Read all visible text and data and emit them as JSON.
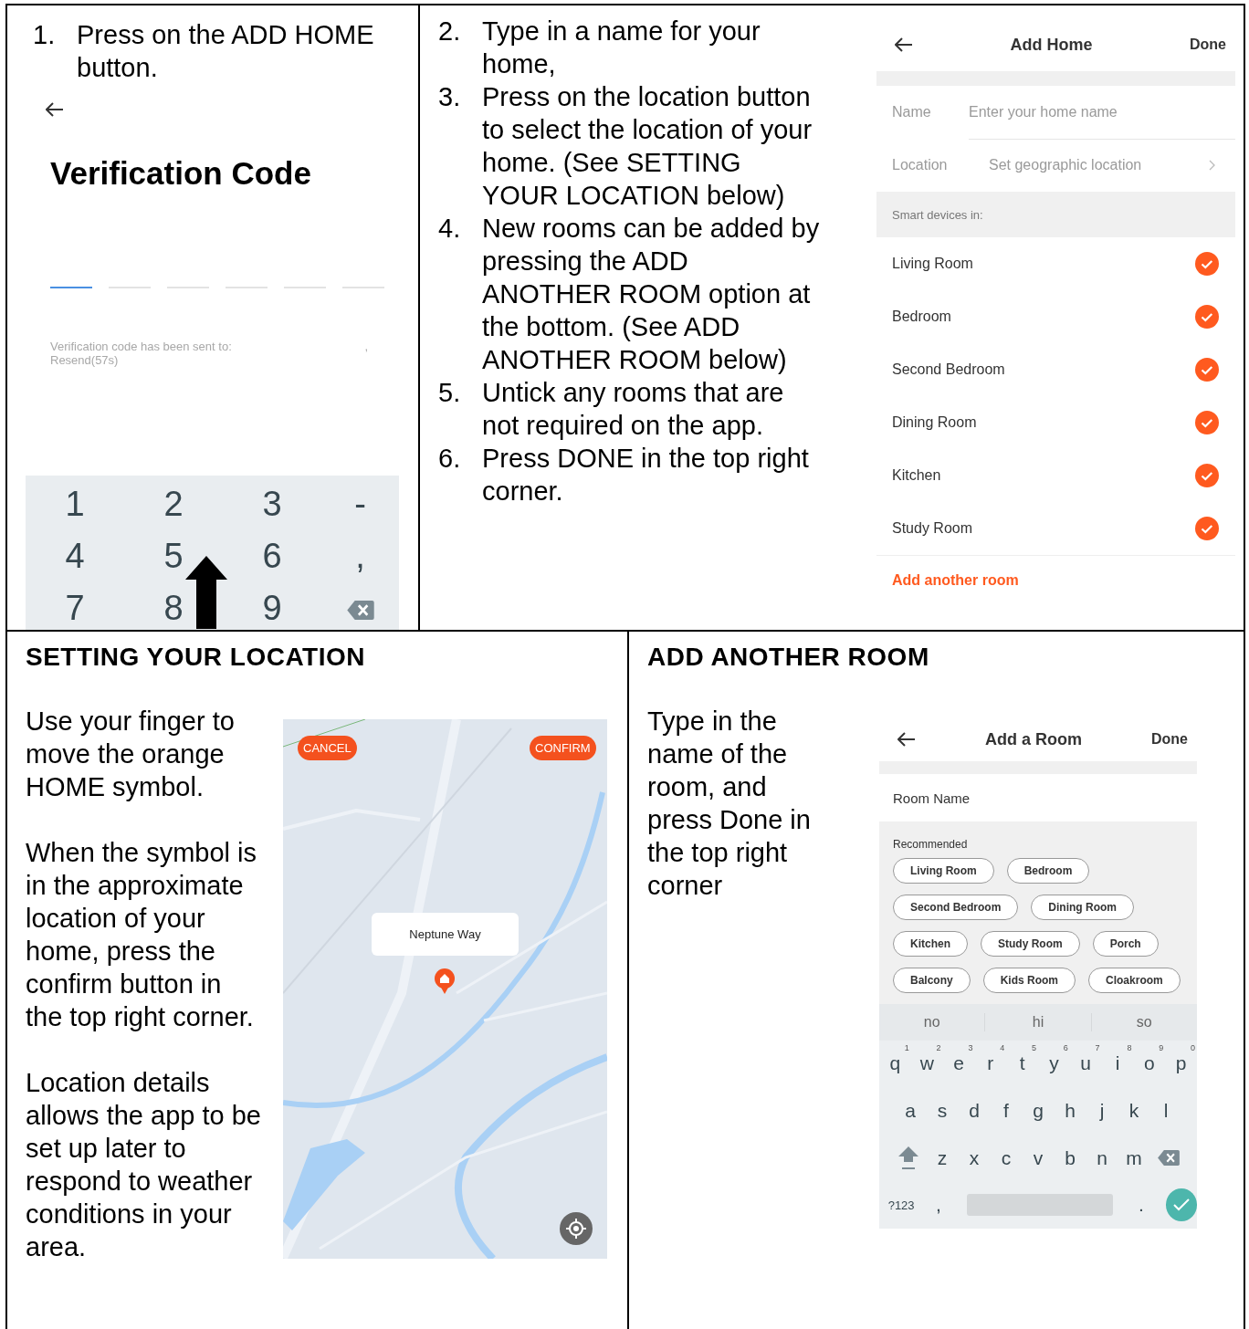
{
  "add_home_step": {
    "steps": [
      {
        "number": "1.",
        "text": "Press on the ADD HOME button."
      }
    ],
    "screen": {
      "title": "Verification Code",
      "code_slots": [
        {
          "selected": true
        },
        {
          "selected": false
        },
        {
          "selected": false
        },
        {
          "selected": false
        },
        {
          "selected": false
        },
        {
          "selected": false
        }
      ],
      "message": "Verification code has been sent to:",
      "message_tail": ",",
      "resend": "Resend(57s)",
      "keypad": [
        {
          "kind": "char",
          "label": "1"
        },
        {
          "kind": "char",
          "label": "2"
        },
        {
          "kind": "char",
          "label": "3"
        },
        {
          "kind": "char",
          "label": "-"
        },
        {
          "kind": "char",
          "label": "4"
        },
        {
          "kind": "char",
          "label": "5"
        },
        {
          "kind": "char",
          "label": "6"
        },
        {
          "kind": "char",
          "label": ","
        },
        {
          "kind": "char",
          "label": "7"
        },
        {
          "kind": "char",
          "label": "8"
        },
        {
          "kind": "char",
          "label": "9"
        },
        {
          "kind": "backspace"
        }
      ]
    }
  },
  "name_home_step": {
    "steps": [
      {
        "number": "2.",
        "text": "Type in a name for your home,"
      },
      {
        "number": "3.",
        "text": "Press on the location button to select the location of your home.  (See SETTING YOUR LOCATION below)"
      },
      {
        "number": "4.",
        "text": "New rooms can be added by pressing the ADD ANOTHER ROOM option at the bottom. (See ADD ANOTHER ROOM below)"
      },
      {
        "number": "5.",
        "text": "Untick any rooms that are not required on the app."
      },
      {
        "number": "6.",
        "text": "Press DONE in the top right corner."
      }
    ],
    "screen": {
      "title": "Add Home",
      "done": "Done",
      "name_label": "Name",
      "name_placeholder": "Enter your home name",
      "location_label": "Location",
      "location_value": "Set geographic location",
      "section_label": "Smart devices in:",
      "rooms": [
        {
          "name": "Living Room",
          "checked": true
        },
        {
          "name": "Bedroom",
          "checked": true
        },
        {
          "name": "Second Bedroom",
          "checked": true
        },
        {
          "name": "Dining Room",
          "checked": true
        },
        {
          "name": "Kitchen",
          "checked": true
        },
        {
          "name": "Study Room",
          "checked": true
        }
      ],
      "add_room": "Add another room"
    }
  },
  "location_section": {
    "heading": "SETTING YOUR LOCATION",
    "paragraphs": [
      "Use your finger to move the orange HOME symbol.",
      "When the symbol is in the approximate location of your home, press the confirm button in the top right corner.",
      "Location details allows the app to be set up later to respond to weather conditions in your area."
    ],
    "map": {
      "cancel": "CANCEL",
      "confirm": "CONFIRM",
      "callout": "Neptune Way"
    }
  },
  "add_room_section": {
    "heading": "ADD ANOTHER ROOM",
    "paragraph": "Type in the name of the room, and press Done in the top right corner",
    "screen": {
      "title": "Add a Room",
      "done": "Done",
      "room_name_placeholder": "Room Name",
      "recommended_label": "Recommended",
      "chip_rows": [
        [
          "Living Room",
          "Bedroom"
        ],
        [
          "Second Bedroom",
          "Dining Room"
        ],
        [
          "Kitchen",
          "Study Room",
          "Porch"
        ],
        [
          "Balcony",
          "Kids Room",
          "Cloakroom"
        ]
      ],
      "suggestions": [
        "no",
        "hi",
        "so"
      ],
      "keyboard": [
        [
          {
            "kind": "char",
            "label": "q",
            "hint": "1"
          },
          {
            "kind": "char",
            "label": "w",
            "hint": "2"
          },
          {
            "kind": "char",
            "label": "e",
            "hint": "3"
          },
          {
            "kind": "char",
            "label": "r",
            "hint": "4"
          },
          {
            "kind": "char",
            "label": "t",
            "hint": "5"
          },
          {
            "kind": "char",
            "label": "y",
            "hint": "6"
          },
          {
            "kind": "char",
            "label": "u",
            "hint": "7"
          },
          {
            "kind": "char",
            "label": "i",
            "hint": "8"
          },
          {
            "kind": "char",
            "label": "o",
            "hint": "9"
          },
          {
            "kind": "char",
            "label": "p",
            "hint": "0"
          }
        ],
        [
          {
            "kind": "char",
            "label": "a"
          },
          {
            "kind": "char",
            "label": "s"
          },
          {
            "kind": "char",
            "label": "d"
          },
          {
            "kind": "char",
            "label": "f"
          },
          {
            "kind": "char",
            "label": "g"
          },
          {
            "kind": "char",
            "label": "h"
          },
          {
            "kind": "char",
            "label": "j"
          },
          {
            "kind": "char",
            "label": "k"
          },
          {
            "kind": "char",
            "label": "l"
          }
        ],
        [
          {
            "kind": "shift"
          },
          {
            "kind": "char",
            "label": "z"
          },
          {
            "kind": "char",
            "label": "x"
          },
          {
            "kind": "char",
            "label": "c"
          },
          {
            "kind": "char",
            "label": "v"
          },
          {
            "kind": "char",
            "label": "b"
          },
          {
            "kind": "char",
            "label": "n"
          },
          {
            "kind": "char",
            "label": "m"
          },
          {
            "kind": "backspace"
          }
        ],
        [
          {
            "kind": "mode",
            "label": "?123"
          },
          {
            "kind": "char",
            "label": ","
          },
          {
            "kind": "space"
          },
          {
            "kind": "char",
            "label": "."
          },
          {
            "kind": "enter"
          }
        ]
      ]
    }
  }
}
